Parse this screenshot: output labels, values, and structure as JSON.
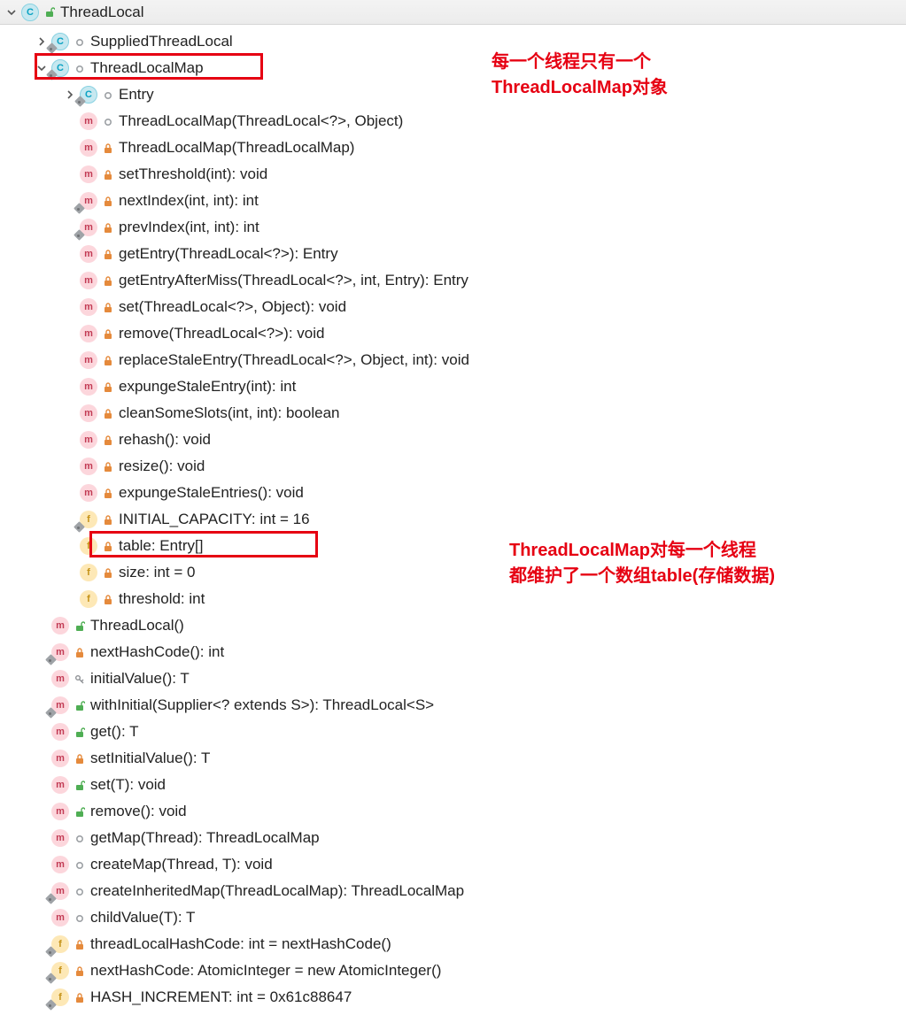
{
  "topbar": {
    "root_label": "ThreadLocal"
  },
  "annotations": {
    "a1_line1": "每一个线程只有一个",
    "a1_line2": "ThreadLocalMap对象",
    "a2_line1": "ThreadLocalMap对每一个线程",
    "a2_line2": "都维护了一个数组table(存储数据)"
  },
  "nodes": [
    {
      "indent": 1,
      "arrow": "right",
      "icon": "class",
      "pin": true,
      "mod": "circle",
      "label": "SuppliedThreadLocal"
    },
    {
      "indent": 1,
      "arrow": "down",
      "icon": "class",
      "pin": true,
      "mod": "circle",
      "label": "ThreadLocalMap"
    },
    {
      "indent": 2,
      "arrow": "right",
      "icon": "class",
      "pin": true,
      "mod": "circle",
      "label": "Entry"
    },
    {
      "indent": 2,
      "arrow": "",
      "icon": "method",
      "pin": false,
      "mod": "circle",
      "label": "ThreadLocalMap(ThreadLocal<?>, Object)"
    },
    {
      "indent": 2,
      "arrow": "",
      "icon": "method",
      "pin": false,
      "mod": "lock",
      "label": "ThreadLocalMap(ThreadLocalMap)"
    },
    {
      "indent": 2,
      "arrow": "",
      "icon": "method",
      "pin": false,
      "mod": "lock",
      "label": "setThreshold(int): void"
    },
    {
      "indent": 2,
      "arrow": "",
      "icon": "method",
      "pin": true,
      "mod": "lock",
      "label": "nextIndex(int, int): int"
    },
    {
      "indent": 2,
      "arrow": "",
      "icon": "method",
      "pin": true,
      "mod": "lock",
      "label": "prevIndex(int, int): int"
    },
    {
      "indent": 2,
      "arrow": "",
      "icon": "method",
      "pin": false,
      "mod": "lock",
      "label": "getEntry(ThreadLocal<?>): Entry"
    },
    {
      "indent": 2,
      "arrow": "",
      "icon": "method",
      "pin": false,
      "mod": "lock",
      "label": "getEntryAfterMiss(ThreadLocal<?>, int, Entry): Entry"
    },
    {
      "indent": 2,
      "arrow": "",
      "icon": "method",
      "pin": false,
      "mod": "lock",
      "label": "set(ThreadLocal<?>, Object): void"
    },
    {
      "indent": 2,
      "arrow": "",
      "icon": "method",
      "pin": false,
      "mod": "lock",
      "label": "remove(ThreadLocal<?>): void"
    },
    {
      "indent": 2,
      "arrow": "",
      "icon": "method",
      "pin": false,
      "mod": "lock",
      "label": "replaceStaleEntry(ThreadLocal<?>, Object, int): void"
    },
    {
      "indent": 2,
      "arrow": "",
      "icon": "method",
      "pin": false,
      "mod": "lock",
      "label": "expungeStaleEntry(int): int"
    },
    {
      "indent": 2,
      "arrow": "",
      "icon": "method",
      "pin": false,
      "mod": "lock",
      "label": "cleanSomeSlots(int, int): boolean"
    },
    {
      "indent": 2,
      "arrow": "",
      "icon": "method",
      "pin": false,
      "mod": "lock",
      "label": "rehash(): void"
    },
    {
      "indent": 2,
      "arrow": "",
      "icon": "method",
      "pin": false,
      "mod": "lock",
      "label": "resize(): void"
    },
    {
      "indent": 2,
      "arrow": "",
      "icon": "method",
      "pin": false,
      "mod": "lock",
      "label": "expungeStaleEntries(): void"
    },
    {
      "indent": 2,
      "arrow": "",
      "icon": "field",
      "pin": true,
      "mod": "lock",
      "label": "INITIAL_CAPACITY: int = 16"
    },
    {
      "indent": 2,
      "arrow": "",
      "icon": "field",
      "pin": false,
      "mod": "lock",
      "label": "table: Entry[]"
    },
    {
      "indent": 2,
      "arrow": "",
      "icon": "field",
      "pin": false,
      "mod": "lock",
      "label": "size: int = 0"
    },
    {
      "indent": 2,
      "arrow": "",
      "icon": "field",
      "pin": false,
      "mod": "lock",
      "label": "threshold: int"
    },
    {
      "indent": 1,
      "arrow": "",
      "icon": "method",
      "pin": false,
      "mod": "unlock",
      "label": "ThreadLocal()"
    },
    {
      "indent": 1,
      "arrow": "",
      "icon": "method",
      "pin": true,
      "mod": "lock",
      "label": "nextHashCode(): int"
    },
    {
      "indent": 1,
      "arrow": "",
      "icon": "method",
      "pin": false,
      "mod": "key",
      "label": "initialValue(): T"
    },
    {
      "indent": 1,
      "arrow": "",
      "icon": "method",
      "pin": true,
      "mod": "unlock",
      "label": "withInitial(Supplier<? extends S>): ThreadLocal<S>"
    },
    {
      "indent": 1,
      "arrow": "",
      "icon": "method",
      "pin": false,
      "mod": "unlock",
      "label": "get(): T"
    },
    {
      "indent": 1,
      "arrow": "",
      "icon": "method",
      "pin": false,
      "mod": "lock",
      "label": "setInitialValue(): T"
    },
    {
      "indent": 1,
      "arrow": "",
      "icon": "method",
      "pin": false,
      "mod": "unlock",
      "label": "set(T): void"
    },
    {
      "indent": 1,
      "arrow": "",
      "icon": "method",
      "pin": false,
      "mod": "unlock",
      "label": "remove(): void"
    },
    {
      "indent": 1,
      "arrow": "",
      "icon": "method",
      "pin": false,
      "mod": "circle",
      "label": "getMap(Thread): ThreadLocalMap"
    },
    {
      "indent": 1,
      "arrow": "",
      "icon": "method",
      "pin": false,
      "mod": "circle",
      "label": "createMap(Thread, T): void"
    },
    {
      "indent": 1,
      "arrow": "",
      "icon": "method",
      "pin": true,
      "mod": "circle",
      "label": "createInheritedMap(ThreadLocalMap): ThreadLocalMap"
    },
    {
      "indent": 1,
      "arrow": "",
      "icon": "method",
      "pin": false,
      "mod": "circle",
      "label": "childValue(T): T"
    },
    {
      "indent": 1,
      "arrow": "",
      "icon": "field",
      "pin": true,
      "mod": "lock",
      "label": "threadLocalHashCode: int = nextHashCode()"
    },
    {
      "indent": 1,
      "arrow": "",
      "icon": "field",
      "pin": true,
      "mod": "lock",
      "label": "nextHashCode: AtomicInteger = new AtomicInteger()"
    },
    {
      "indent": 1,
      "arrow": "",
      "icon": "field",
      "pin": true,
      "mod": "lock",
      "label": "HASH_INCREMENT: int = 0x61c88647"
    }
  ]
}
